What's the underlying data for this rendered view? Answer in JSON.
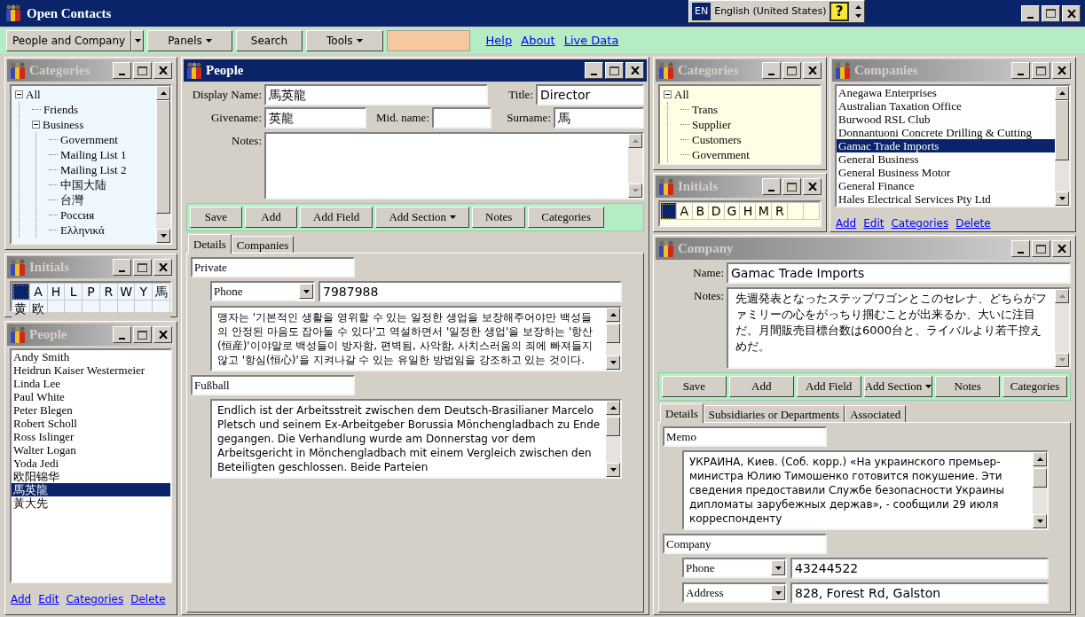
{
  "window": {
    "title": "Open Contacts"
  },
  "language_bar": {
    "code": "EN",
    "language": "English (United States)",
    "help": "?"
  },
  "toolbar": {
    "items": [
      {
        "kind": "split",
        "label": "People and Company"
      },
      {
        "kind": "menu",
        "label": "Panels"
      },
      {
        "kind": "button",
        "label": "Search"
      },
      {
        "kind": "menu",
        "label": "Tools"
      },
      {
        "kind": "field"
      }
    ],
    "links": [
      "Help",
      "About",
      "Live Data"
    ]
  },
  "people_categories": {
    "title": "Categories",
    "active": false,
    "tree": [
      {
        "label": "All",
        "expanded": true,
        "children": [
          {
            "label": "Friends"
          },
          {
            "label": "Business",
            "expanded": true,
            "children": [
              {
                "label": "Government"
              },
              {
                "label": "Mailing List 1"
              },
              {
                "label": "Mailing List 2"
              },
              {
                "label": "中国大陆"
              },
              {
                "label": "台灣"
              },
              {
                "label": "Россия"
              },
              {
                "label": "Ελληνικά"
              }
            ]
          }
        ]
      }
    ]
  },
  "people_initials": {
    "title": "Initials",
    "active": false,
    "cells": [
      {
        "selected": true
      },
      {
        "label": "A",
        "selected": false
      },
      {
        "label": "H",
        "selected": false
      },
      {
        "label": "L",
        "selected": false
      },
      {
        "label": "P",
        "selected": false
      },
      {
        "label": "R",
        "selected": false
      },
      {
        "label": "W",
        "selected": false
      },
      {
        "label": "Y",
        "selected": false
      },
      {
        "label": "馬",
        "selected": false
      },
      {
        "label": "黄",
        "selected": false
      },
      {
        "label": "欧",
        "selected": false
      }
    ]
  },
  "people_list": {
    "title": "People",
    "active": false,
    "items": [
      {
        "label": "Andy Smith",
        "selected": false
      },
      {
        "label": "Heidrun Kaiser Westermeier",
        "selected": false
      },
      {
        "label": "Linda Lee",
        "selected": false
      },
      {
        "label": "Paul White",
        "selected": false
      },
      {
        "label": "Peter Blegen",
        "selected": false
      },
      {
        "label": "Robert Scholl",
        "selected": false
      },
      {
        "label": "Ross  Islinger",
        "selected": false
      },
      {
        "label": "Walter Logan",
        "selected": false
      },
      {
        "label": "Yoda Jedi",
        "selected": false
      },
      {
        "label": "欧阳锦华",
        "selected": false
      },
      {
        "label": "馬英龍",
        "selected": true
      },
      {
        "label": "黃大先",
        "selected": false
      }
    ],
    "links": [
      "Add",
      "Edit",
      "Categories",
      "Delete"
    ]
  },
  "person": {
    "title": "People",
    "active": true,
    "fields": {
      "display_name": {
        "label": "Display Name:",
        "value": "馬英龍"
      },
      "title": {
        "label": "Title:",
        "value": "Director"
      },
      "givename": {
        "label": "Givename:",
        "value": "英龍"
      },
      "mid_name": {
        "label": "Mid. name:"
      },
      "surname": {
        "label": "Surname:",
        "value": "馬"
      },
      "notes": {
        "label": "Notes:"
      }
    },
    "buttons": [
      {
        "kind": "button",
        "label": "Save"
      },
      {
        "kind": "button",
        "label": "Add"
      },
      {
        "kind": "button",
        "label": "Add Field"
      },
      {
        "kind": "menu",
        "label": "Add Section"
      },
      {
        "kind": "button",
        "label": "Notes"
      },
      {
        "kind": "button",
        "label": "Categories"
      }
    ],
    "tabs": [
      {
        "label": "Details",
        "selected": true
      },
      {
        "label": "Companies",
        "selected": false
      }
    ],
    "sections": [
      {
        "heading": "Private",
        "fields": [
          {
            "kind": "typed",
            "type": "Phone",
            "value": "7987988"
          },
          {
            "kind": "memo",
            "text": "맹자는 '기본적인 생활을 영위할 수 있는 일정한 생업을 보장해주어야만 백성들의 안정된 마음도 잡아둘 수 있다'고 역설하면서 '일정한 생업'을 보장하는 '항산(恒産)'이야말로 백성들이 방자함, 편벽됨, 사악함, 사치스러움의 죄에 빠져들지 않고 '항심(恒心)'을 지켜나갈 수 있는 유일한 방법임을 강조하고 있는 것이다."
          }
        ]
      },
      {
        "heading": "Fußball",
        "fields": [
          {
            "kind": "memo",
            "text": "Endlich ist der Arbeitsstreit zwischen dem Deutsch-Brasilianer Marcelo Pletsch und seinem Ex-Arbeitgeber Borussia Mönchengladbach zu Ende gegangen. Die Verhandlung wurde am Donnerstag vor dem Arbeitsgericht in Mönchengladbach mit einem Vergleich zwischen den Beteiligten geschlossen. Beide Parteien"
          }
        ]
      }
    ]
  },
  "company_categories": {
    "title": "Categories",
    "active": false,
    "tree": [
      {
        "label": "All",
        "expanded": true,
        "children": [
          {
            "label": "Trans"
          },
          {
            "label": "Supplier"
          },
          {
            "label": "Customers"
          },
          {
            "label": "Government"
          }
        ]
      }
    ]
  },
  "company_initials": {
    "title": "Initials",
    "active": false,
    "cells": [
      {
        "selected": true
      },
      {
        "label": "A",
        "selected": false
      },
      {
        "label": "B",
        "selected": false
      },
      {
        "label": "D",
        "selected": false
      },
      {
        "label": "G",
        "selected": false
      },
      {
        "label": "H",
        "selected": false
      },
      {
        "label": "M",
        "selected": false
      },
      {
        "label": "R",
        "selected": false
      }
    ]
  },
  "companies": {
    "title": "Companies",
    "active": false,
    "items": [
      {
        "label": "Anegawa Enterprises",
        "selected": false
      },
      {
        "label": "Australian Taxation Office",
        "selected": false
      },
      {
        "label": "Burwood RSL Club",
        "selected": false
      },
      {
        "label": "Donnantuoni Concrete Drilling & Cutting",
        "selected": false
      },
      {
        "label": "Gamac Trade Imports",
        "selected": true
      },
      {
        "label": "General Business",
        "selected": false
      },
      {
        "label": "General Business Motor",
        "selected": false
      },
      {
        "label": "General Finance",
        "selected": false
      },
      {
        "label": "Hales Electrical Services Pty Ltd",
        "selected": false
      }
    ],
    "links": [
      "Add",
      "Edit",
      "Categories",
      "Delete"
    ]
  },
  "company": {
    "title": "Company",
    "active": false,
    "fields": {
      "name": {
        "label": "Name:",
        "value": "Gamac Trade Imports"
      },
      "notes": {
        "label": "Notes:",
        "value": "先週発表となったステップワゴンとこのセレナ、どちらがファミリーの心をがっちり掴むことが出来るか、大いに注目だ。月間販売目標台数は6000台と、ライバルより若干控えめだ。"
      }
    },
    "buttons": [
      {
        "kind": "button",
        "label": "Save"
      },
      {
        "kind": "button",
        "label": "Add"
      },
      {
        "kind": "button",
        "label": "Add Field"
      },
      {
        "kind": "menu",
        "label": "Add Section"
      },
      {
        "kind": "button",
        "label": "Notes"
      },
      {
        "kind": "button",
        "label": "Categories"
      }
    ],
    "tabs": [
      {
        "label": "Details",
        "selected": true
      },
      {
        "label": "Subsidiaries or Departments",
        "selected": false
      },
      {
        "label": "Associated",
        "selected": false
      }
    ],
    "sections": [
      {
        "heading": "Memo",
        "fields": [
          {
            "kind": "memo",
            "text": "УКРАИНА, Киев. (Соб. корр.) «На украинского премьер-министра Юлию Тимошенко готовится покушение. Эти сведения предоставили Службе безопасности Украины дипломаты зарубежных держав», - сообщили 29 июля корреспонденту"
          }
        ]
      },
      {
        "heading": "Company",
        "fields": [
          {
            "kind": "typed",
            "type": "Phone",
            "value": "43244522"
          },
          {
            "kind": "typed",
            "type": "Address",
            "value": "828, Forest Rd, Galston"
          }
        ]
      }
    ]
  }
}
